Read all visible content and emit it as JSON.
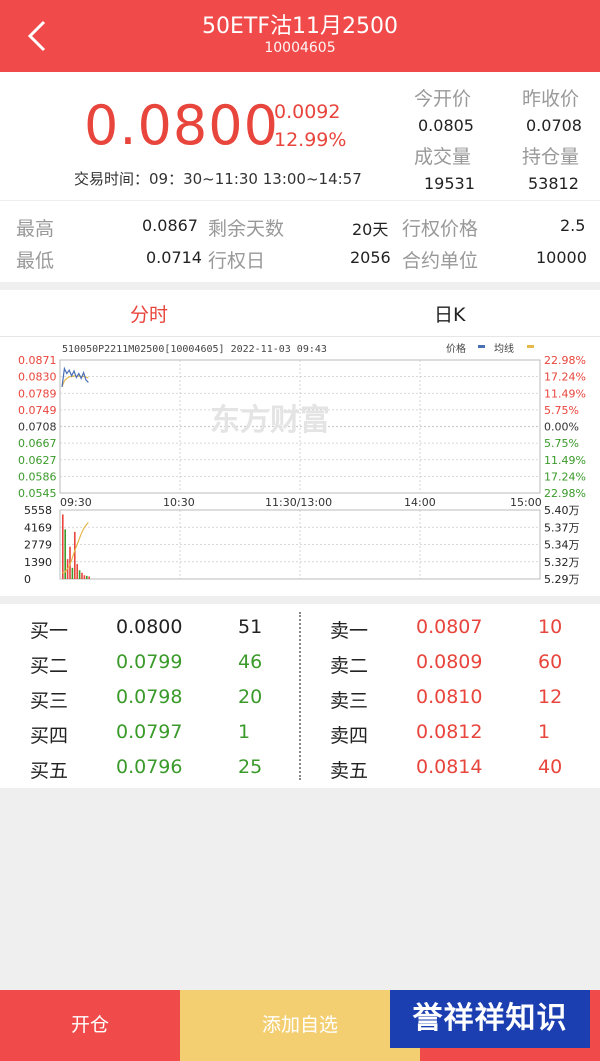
{
  "header": {
    "title": "50ETF沽11月2500",
    "code": "10004605"
  },
  "quote": {
    "price": "0.0800",
    "change": "0.0092",
    "change_pct": "12.99%",
    "trade_time": "交易时间：09：30~11:30 13:00~14:57",
    "open_label": "今开价",
    "open_value": "0.0805",
    "prev_close_label": "昨收价",
    "prev_close_value": "0.0708",
    "volume_label": "成交量",
    "volume_value": "19531",
    "oi_label": "持仓量",
    "oi_value": "53812"
  },
  "details": {
    "high_label": "最高",
    "high_value": "0.0867",
    "low_label": "最低",
    "low_value": "0.0714",
    "days_left_label": "剩余天数",
    "days_left_value": "20天",
    "exercise_date_label": "行权日",
    "exercise_date_value": "2056",
    "strike_label": "行权价格",
    "strike_value": "2.5",
    "unit_label": "合约单位",
    "unit_value": "10000"
  },
  "tabs": {
    "intraday": "分时",
    "daily": "日K"
  },
  "chart_data": {
    "type": "line",
    "header_text": "510050P2211M02500[10004605] 2022-11-03 09:43",
    "legend": [
      "价格",
      "均线"
    ],
    "y_left_ticks": [
      "0.0871",
      "0.0830",
      "0.0789",
      "0.0749",
      "0.0708",
      "0.0667",
      "0.0627",
      "0.0586",
      "0.0545"
    ],
    "y_right_ticks": [
      "22.98%",
      "17.24%",
      "11.49%",
      "5.75%",
      "0.00%",
      "5.75%",
      "11.49%",
      "17.24%",
      "22.98%"
    ],
    "x_ticks": [
      "09:30",
      "10:30",
      "11:30/13:00",
      "14:00",
      "15:00"
    ],
    "ylim": [
      0.0545,
      0.0871
    ],
    "price_series": [
      0.0805,
      0.085,
      0.0838,
      0.0846,
      0.0832,
      0.0844,
      0.0828,
      0.0838,
      0.0826,
      0.084,
      0.0822,
      0.0816
    ],
    "avg_series": [
      0.0805,
      0.082,
      0.0826,
      0.083,
      0.083,
      0.0832,
      0.0831,
      0.0832,
      0.083,
      0.0831,
      0.0829,
      0.0827
    ],
    "volume_left_ticks": [
      "5558",
      "4169",
      "2779",
      "1390",
      "0"
    ],
    "volume_right_ticks": [
      "5.40万",
      "5.37万",
      "5.34万",
      "5.32万",
      "5.29万"
    ],
    "volume_ylim": [
      0,
      5558
    ],
    "volume_series": [
      5200,
      4000,
      1600,
      2600,
      900,
      3800,
      1200,
      700,
      500,
      300,
      250,
      200
    ],
    "oi_series": [
      53000,
      53000,
      53050,
      53100,
      53200,
      53320,
      53420,
      53520,
      53620,
      53700,
      53760,
      53800
    ],
    "oi_ylim": [
      52900,
      54000
    ]
  },
  "order_book": {
    "bids": [
      {
        "label": "买一",
        "price": "0.0800",
        "qty": "51"
      },
      {
        "label": "买二",
        "price": "0.0799",
        "qty": "46"
      },
      {
        "label": "买三",
        "price": "0.0798",
        "qty": "20"
      },
      {
        "label": "买四",
        "price": "0.0797",
        "qty": "1"
      },
      {
        "label": "买五",
        "price": "0.0796",
        "qty": "25"
      }
    ],
    "asks": [
      {
        "label": "卖一",
        "price": "0.0807",
        "qty": "10"
      },
      {
        "label": "卖二",
        "price": "0.0809",
        "qty": "60"
      },
      {
        "label": "卖三",
        "price": "0.0810",
        "qty": "12"
      },
      {
        "label": "卖四",
        "price": "0.0812",
        "qty": "1"
      },
      {
        "label": "卖五",
        "price": "0.0814",
        "qty": "40"
      }
    ]
  },
  "bottom": {
    "open_position": "开仓",
    "add_watchlist": "添加自选"
  },
  "watermarks": {
    "chart": "东方财富",
    "corner": "誉祥祥知识"
  },
  "colors": {
    "red": "#e8453c",
    "green": "#3a9a2a",
    "header_bg": "#f04a4a",
    "price_line": "#4a6fb5",
    "avg_line": "#e6b84a"
  }
}
